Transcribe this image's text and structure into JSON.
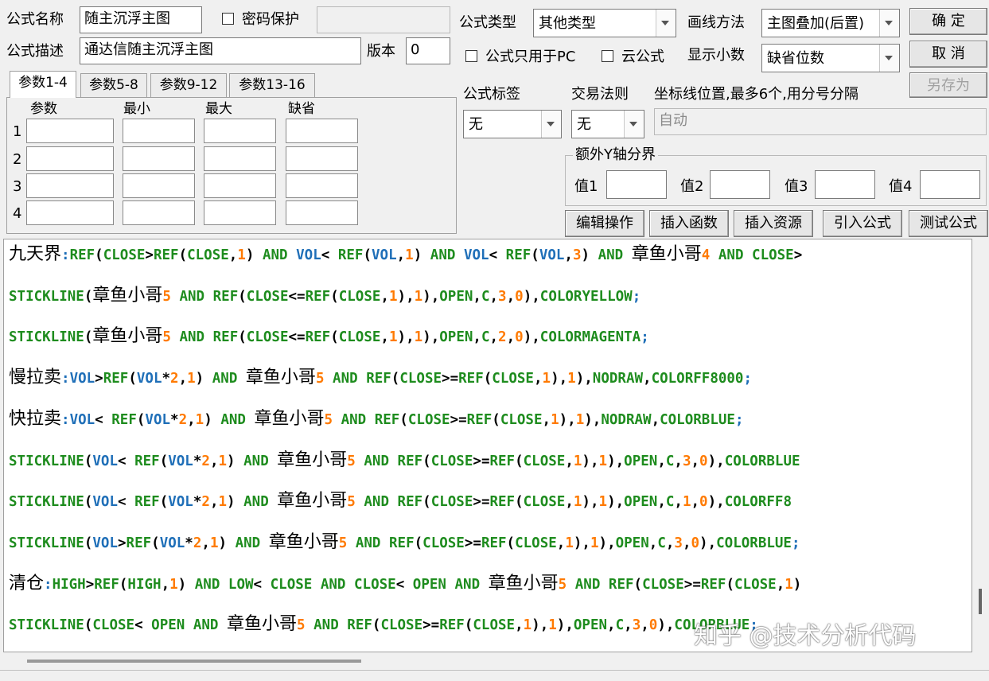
{
  "form": {
    "name_label": "公式名称",
    "name_value": "随主沉浮主图",
    "password_label": "密码保护",
    "password_value": "",
    "desc_label": "公式描述",
    "desc_value": "通达信随主沉浮主图",
    "version_label": "版本",
    "version_value": "0",
    "type_label": "公式类型",
    "type_value": "其他类型",
    "draw_label": "画线方法",
    "draw_value": "主图叠加(后置)",
    "pc_only_label": "公式只用于PC",
    "cloud_label": "云公式",
    "decimals_label": "显示小数",
    "decimals_value": "缺省位数",
    "tag_label": "公式标签",
    "tag_value": "无",
    "rule_label": "交易法则",
    "rule_value": "无",
    "coord_label": "坐标线位置,最多6个,用分号分隔",
    "coord_value": "自动",
    "yaxis_group_label": "额外Y轴分界",
    "yaxis_values": [
      "值1",
      "值2",
      "值3",
      "值4"
    ]
  },
  "buttons": {
    "ok": "确 定",
    "cancel": "取 消",
    "save_as": "另存为",
    "edit_ops": "编辑操作",
    "insert_func": "插入函数",
    "insert_res": "插入资源",
    "import_formula": "引入公式",
    "test_formula": "测试公式"
  },
  "tabs": [
    "参数1-4",
    "参数5-8",
    "参数9-12",
    "参数13-16"
  ],
  "params": {
    "headers": [
      "参数",
      "最小",
      "最大",
      "缺省"
    ],
    "rows": [
      "1",
      "2",
      "3",
      "4"
    ]
  },
  "code_lines": [
    "九天界:REF(CLOSE>REF(CLOSE,1) AND VOL< REF(VOL,1) AND VOL< REF(VOL,3) AND 章鱼小哥4 AND CLOSE>",
    "STICKLINE(章鱼小哥5 AND REF(CLOSE<=REF(CLOSE,1),1),OPEN,C,3,0),COLORYELLOW;",
    "STICKLINE(章鱼小哥5 AND REF(CLOSE<=REF(CLOSE,1),1),OPEN,C,2,0),COLORMAGENTA;",
    "慢拉卖:VOL>REF(VOL*2,1) AND 章鱼小哥5 AND REF(CLOSE>=REF(CLOSE,1),1),NODRAW,COLORFF8000;",
    "快拉卖:VOL< REF(VOL*2,1) AND 章鱼小哥5 AND REF(CLOSE>=REF(CLOSE,1),1),NODRAW,COLORBLUE;",
    "STICKLINE(VOL< REF(VOL*2,1) AND 章鱼小哥5 AND REF(CLOSE>=REF(CLOSE,1),1),OPEN,C,3,0),COLORBLUE",
    "STICKLINE(VOL< REF(VOL*2,1) AND 章鱼小哥5 AND REF(CLOSE>=REF(CLOSE,1),1),OPEN,C,1,0),COLORFF8",
    "STICKLINE(VOL>REF(VOL*2,1) AND 章鱼小哥5 AND REF(CLOSE>=REF(CLOSE,1),1),OPEN,C,3,0),COLORBLUE;",
    "清仓:HIGH>REF(HIGH,1) AND LOW< CLOSE AND CLOSE< OPEN AND 章鱼小哥5 AND REF(CLOSE>=REF(CLOSE,1)",
    "STICKLINE(CLOSE< OPEN AND 章鱼小哥5 AND REF(CLOSE>=REF(CLOSE,1),1),OPEN,C,3,0),COLORBLUE;"
  ],
  "watermark": "知乎 @技术分析代码",
  "colors": {
    "keyword": "#1e8c1e",
    "variable": "#1f6fb8",
    "number": "#ff7a00",
    "text": "#000000"
  }
}
